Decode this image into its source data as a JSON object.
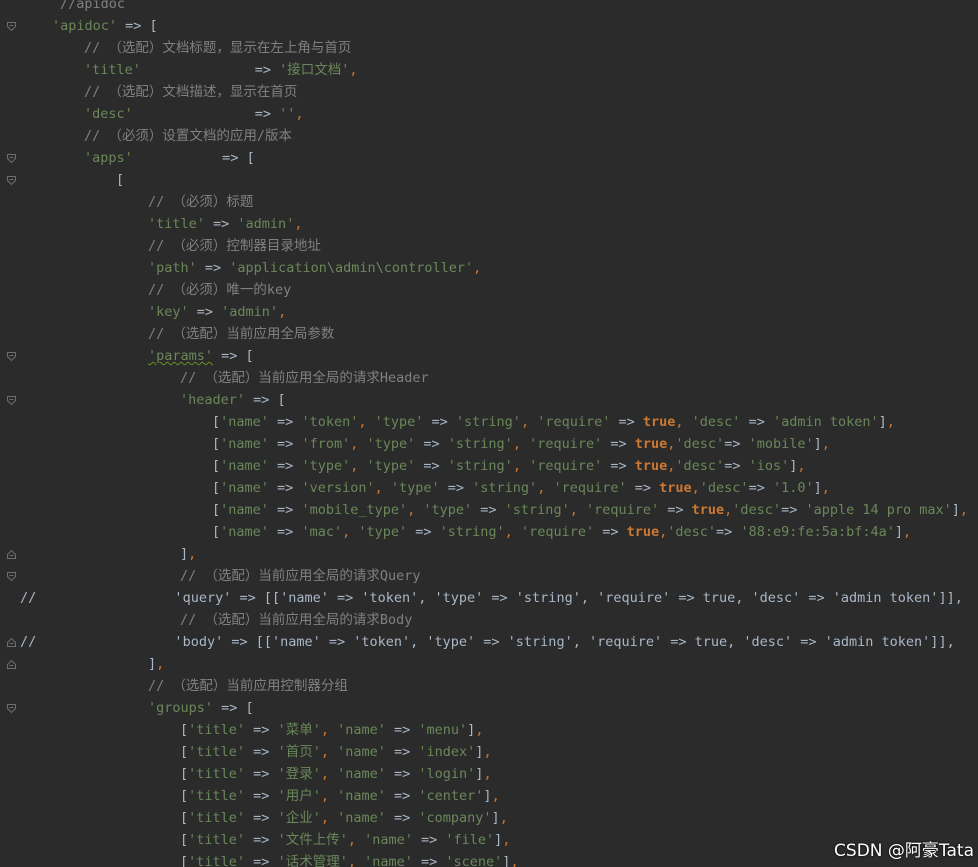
{
  "lines": [
    {
      "indent": 60,
      "tokens": [
        {
          "t": "//apidoc",
          "c": "com"
        }
      ]
    },
    {
      "indent": 52,
      "fold": "open",
      "tokens": [
        {
          "t": "'apidoc'",
          "c": "str"
        },
        {
          "t": " => [",
          "c": "p"
        }
      ]
    },
    {
      "indent": 84,
      "tokens": [
        {
          "t": "// （选配）文档标题，显示在左上角与首页",
          "c": "com"
        }
      ]
    },
    {
      "indent": 84,
      "tokens": [
        {
          "t": "'title'",
          "c": "str"
        },
        {
          "t": "              => ",
          "c": "p"
        },
        {
          "t": "'接口文档'",
          "c": "str"
        },
        {
          "t": ",",
          "c": "pc"
        }
      ]
    },
    {
      "indent": 84,
      "tokens": [
        {
          "t": "// （选配）文档描述，显示在首页",
          "c": "com"
        }
      ]
    },
    {
      "indent": 84,
      "tokens": [
        {
          "t": "'desc'",
          "c": "str"
        },
        {
          "t": "               => ",
          "c": "p"
        },
        {
          "t": "''",
          "c": "str"
        },
        {
          "t": ",",
          "c": "pc"
        }
      ]
    },
    {
      "indent": 84,
      "tokens": [
        {
          "t": "// （必须）设置文档的应用/版本",
          "c": "com"
        }
      ]
    },
    {
      "indent": 84,
      "fold": "open",
      "tokens": [
        {
          "t": "'apps'",
          "c": "str"
        },
        {
          "t": "           => [",
          "c": "p"
        }
      ]
    },
    {
      "indent": 116,
      "fold": "open",
      "tokens": [
        {
          "t": "[",
          "c": "p"
        }
      ]
    },
    {
      "indent": 148,
      "tokens": [
        {
          "t": "// （必须）标题",
          "c": "com"
        }
      ]
    },
    {
      "indent": 148,
      "tokens": [
        {
          "t": "'title'",
          "c": "str"
        },
        {
          "t": " => ",
          "c": "p"
        },
        {
          "t": "'admin'",
          "c": "str"
        },
        {
          "t": ",",
          "c": "pc"
        }
      ]
    },
    {
      "indent": 148,
      "tokens": [
        {
          "t": "// （必须）控制器目录地址",
          "c": "com"
        }
      ]
    },
    {
      "indent": 148,
      "tokens": [
        {
          "t": "'path'",
          "c": "str"
        },
        {
          "t": " => ",
          "c": "p"
        },
        {
          "t": "'application\\admin\\controller'",
          "c": "str"
        },
        {
          "t": ",",
          "c": "pc"
        }
      ]
    },
    {
      "indent": 148,
      "tokens": [
        {
          "t": "// （必须）唯一的key",
          "c": "com"
        }
      ]
    },
    {
      "indent": 148,
      "tokens": [
        {
          "t": "'key'",
          "c": "str"
        },
        {
          "t": " => ",
          "c": "p"
        },
        {
          "t": "'admin'",
          "c": "str"
        },
        {
          "t": ",",
          "c": "pc"
        }
      ]
    },
    {
      "indent": 148,
      "tokens": [
        {
          "t": "// （选配）当前应用全局参数",
          "c": "com"
        }
      ]
    },
    {
      "indent": 148,
      "fold": "open",
      "tokens": [
        {
          "t": "'params'",
          "c": "str",
          "sq": true
        },
        {
          "t": " => [",
          "c": "p"
        }
      ]
    },
    {
      "indent": 180,
      "tokens": [
        {
          "t": "// （选配）当前应用全局的请求Header",
          "c": "com"
        }
      ]
    },
    {
      "indent": 180,
      "fold": "open",
      "tokens": [
        {
          "t": "'header'",
          "c": "str"
        },
        {
          "t": " => [",
          "c": "p"
        }
      ]
    },
    {
      "indent": 212,
      "tokens": [
        {
          "t": "[",
          "c": "p"
        },
        {
          "t": "'name'",
          "c": "str"
        },
        {
          "t": " => ",
          "c": "p"
        },
        {
          "t": "'token'",
          "c": "str"
        },
        {
          "t": ", ",
          "c": "pc"
        },
        {
          "t": "'type'",
          "c": "str"
        },
        {
          "t": " => ",
          "c": "p"
        },
        {
          "t": "'string'",
          "c": "str"
        },
        {
          "t": ", ",
          "c": "pc"
        },
        {
          "t": "'require'",
          "c": "str"
        },
        {
          "t": " => ",
          "c": "p"
        },
        {
          "t": "true",
          "c": "kw"
        },
        {
          "t": ", ",
          "c": "pc"
        },
        {
          "t": "'desc'",
          "c": "str"
        },
        {
          "t": " => ",
          "c": "p"
        },
        {
          "t": "'admin token'",
          "c": "str"
        },
        {
          "t": "]",
          "c": "p"
        },
        {
          "t": ",",
          "c": "pc"
        }
      ]
    },
    {
      "indent": 212,
      "tokens": [
        {
          "t": "[",
          "c": "p"
        },
        {
          "t": "'name'",
          "c": "str"
        },
        {
          "t": " => ",
          "c": "p"
        },
        {
          "t": "'from'",
          "c": "str"
        },
        {
          "t": ", ",
          "c": "pc"
        },
        {
          "t": "'type'",
          "c": "str"
        },
        {
          "t": " => ",
          "c": "p"
        },
        {
          "t": "'string'",
          "c": "str"
        },
        {
          "t": ", ",
          "c": "pc"
        },
        {
          "t": "'require'",
          "c": "str"
        },
        {
          "t": " => ",
          "c": "p"
        },
        {
          "t": "true",
          "c": "kw"
        },
        {
          "t": ",",
          "c": "pc"
        },
        {
          "t": "'desc'",
          "c": "str"
        },
        {
          "t": "=> ",
          "c": "p"
        },
        {
          "t": "'mobile'",
          "c": "str"
        },
        {
          "t": "]",
          "c": "p"
        },
        {
          "t": ",",
          "c": "pc"
        }
      ]
    },
    {
      "indent": 212,
      "tokens": [
        {
          "t": "[",
          "c": "p"
        },
        {
          "t": "'name'",
          "c": "str"
        },
        {
          "t": " => ",
          "c": "p"
        },
        {
          "t": "'type'",
          "c": "str"
        },
        {
          "t": ", ",
          "c": "pc"
        },
        {
          "t": "'type'",
          "c": "str"
        },
        {
          "t": " => ",
          "c": "p"
        },
        {
          "t": "'string'",
          "c": "str"
        },
        {
          "t": ", ",
          "c": "pc"
        },
        {
          "t": "'require'",
          "c": "str"
        },
        {
          "t": " => ",
          "c": "p"
        },
        {
          "t": "true",
          "c": "kw"
        },
        {
          "t": ",",
          "c": "pc"
        },
        {
          "t": "'desc'",
          "c": "str"
        },
        {
          "t": "=> ",
          "c": "p"
        },
        {
          "t": "'ios'",
          "c": "str"
        },
        {
          "t": "]",
          "c": "p"
        },
        {
          "t": ",",
          "c": "pc"
        }
      ]
    },
    {
      "indent": 212,
      "tokens": [
        {
          "t": "[",
          "c": "p"
        },
        {
          "t": "'name'",
          "c": "str"
        },
        {
          "t": " => ",
          "c": "p"
        },
        {
          "t": "'version'",
          "c": "str"
        },
        {
          "t": ", ",
          "c": "pc"
        },
        {
          "t": "'type'",
          "c": "str"
        },
        {
          "t": " => ",
          "c": "p"
        },
        {
          "t": "'string'",
          "c": "str"
        },
        {
          "t": ", ",
          "c": "pc"
        },
        {
          "t": "'require'",
          "c": "str"
        },
        {
          "t": " => ",
          "c": "p"
        },
        {
          "t": "true",
          "c": "kw"
        },
        {
          "t": ",",
          "c": "pc"
        },
        {
          "t": "'desc'",
          "c": "str"
        },
        {
          "t": "=> ",
          "c": "p"
        },
        {
          "t": "'1.0'",
          "c": "str"
        },
        {
          "t": "]",
          "c": "p"
        },
        {
          "t": ",",
          "c": "pc"
        }
      ]
    },
    {
      "indent": 212,
      "tokens": [
        {
          "t": "[",
          "c": "p"
        },
        {
          "t": "'name'",
          "c": "str"
        },
        {
          "t": " => ",
          "c": "p"
        },
        {
          "t": "'mobile_type'",
          "c": "str"
        },
        {
          "t": ", ",
          "c": "pc"
        },
        {
          "t": "'type'",
          "c": "str"
        },
        {
          "t": " => ",
          "c": "p"
        },
        {
          "t": "'string'",
          "c": "str"
        },
        {
          "t": ", ",
          "c": "pc"
        },
        {
          "t": "'require'",
          "c": "str"
        },
        {
          "t": " => ",
          "c": "p"
        },
        {
          "t": "true",
          "c": "kw"
        },
        {
          "t": ",",
          "c": "pc"
        },
        {
          "t": "'desc'",
          "c": "str"
        },
        {
          "t": "=> ",
          "c": "p"
        },
        {
          "t": "'apple 14 pro max'",
          "c": "str"
        },
        {
          "t": "]",
          "c": "p"
        },
        {
          "t": ",",
          "c": "pc"
        }
      ]
    },
    {
      "indent": 212,
      "tokens": [
        {
          "t": "[",
          "c": "p"
        },
        {
          "t": "'name'",
          "c": "str"
        },
        {
          "t": " => ",
          "c": "p"
        },
        {
          "t": "'mac'",
          "c": "str"
        },
        {
          "t": ", ",
          "c": "pc"
        },
        {
          "t": "'type'",
          "c": "str"
        },
        {
          "t": " => ",
          "c": "p"
        },
        {
          "t": "'string'",
          "c": "str"
        },
        {
          "t": ", ",
          "c": "pc"
        },
        {
          "t": "'require'",
          "c": "str"
        },
        {
          "t": " => ",
          "c": "p"
        },
        {
          "t": "true",
          "c": "kw"
        },
        {
          "t": ",",
          "c": "pc"
        },
        {
          "t": "'desc'",
          "c": "str"
        },
        {
          "t": "=> ",
          "c": "p"
        },
        {
          "t": "'88:e9:fe:5a:bf:4a'",
          "c": "str"
        },
        {
          "t": "]",
          "c": "p"
        },
        {
          "t": ",",
          "c": "pc"
        }
      ]
    },
    {
      "indent": 180,
      "fold": "close",
      "tokens": [
        {
          "t": "]",
          "c": "p"
        },
        {
          "t": ",",
          "c": "pc"
        }
      ]
    },
    {
      "indent": 180,
      "fold": "open",
      "tokens": [
        {
          "t": "// （选配）当前应用全局的请求Query",
          "c": "com"
        }
      ]
    },
    {
      "indent": 20,
      "tokens": [
        {
          "t": "//",
          "c": "p"
        },
        {
          "t": "                 'query' => [['name' => 'token', 'type' => 'string', 'require' => true, 'desc' => 'admin token']],",
          "c": "p"
        }
      ]
    },
    {
      "indent": 180,
      "tokens": [
        {
          "t": "// （选配）当前应用全局的请求Body",
          "c": "com"
        }
      ]
    },
    {
      "indent": 20,
      "fold": "close",
      "tokens": [
        {
          "t": "//",
          "c": "p"
        },
        {
          "t": "                 'body' => [['name' => 'token', 'type' => 'string', 'require' => true, 'desc' => 'admin token']],",
          "c": "p"
        }
      ]
    },
    {
      "indent": 148,
      "fold": "close",
      "tokens": [
        {
          "t": "]",
          "c": "p"
        },
        {
          "t": ",",
          "c": "pc"
        }
      ]
    },
    {
      "indent": 148,
      "tokens": [
        {
          "t": "// （选配）当前应用控制器分组",
          "c": "com"
        }
      ]
    },
    {
      "indent": 148,
      "fold": "open",
      "tokens": [
        {
          "t": "'groups'",
          "c": "str"
        },
        {
          "t": " => [",
          "c": "p"
        }
      ]
    },
    {
      "indent": 180,
      "tokens": [
        {
          "t": "[",
          "c": "p"
        },
        {
          "t": "'title'",
          "c": "str"
        },
        {
          "t": " => ",
          "c": "p"
        },
        {
          "t": "'菜单'",
          "c": "str"
        },
        {
          "t": ", ",
          "c": "pc"
        },
        {
          "t": "'name'",
          "c": "str"
        },
        {
          "t": " => ",
          "c": "p"
        },
        {
          "t": "'menu'",
          "c": "str"
        },
        {
          "t": "]",
          "c": "p"
        },
        {
          "t": ",",
          "c": "pc"
        }
      ]
    },
    {
      "indent": 180,
      "tokens": [
        {
          "t": "[",
          "c": "p"
        },
        {
          "t": "'title'",
          "c": "str"
        },
        {
          "t": " => ",
          "c": "p"
        },
        {
          "t": "'首页'",
          "c": "str"
        },
        {
          "t": ", ",
          "c": "pc"
        },
        {
          "t": "'name'",
          "c": "str"
        },
        {
          "t": " => ",
          "c": "p"
        },
        {
          "t": "'index'",
          "c": "str"
        },
        {
          "t": "]",
          "c": "p"
        },
        {
          "t": ",",
          "c": "pc"
        }
      ]
    },
    {
      "indent": 180,
      "tokens": [
        {
          "t": "[",
          "c": "p"
        },
        {
          "t": "'title'",
          "c": "str"
        },
        {
          "t": " => ",
          "c": "p"
        },
        {
          "t": "'登录'",
          "c": "str"
        },
        {
          "t": ", ",
          "c": "pc"
        },
        {
          "t": "'name'",
          "c": "str"
        },
        {
          "t": " => ",
          "c": "p"
        },
        {
          "t": "'login'",
          "c": "str"
        },
        {
          "t": "]",
          "c": "p"
        },
        {
          "t": ",",
          "c": "pc"
        }
      ]
    },
    {
      "indent": 180,
      "tokens": [
        {
          "t": "[",
          "c": "p"
        },
        {
          "t": "'title'",
          "c": "str"
        },
        {
          "t": " => ",
          "c": "p"
        },
        {
          "t": "'用户'",
          "c": "str"
        },
        {
          "t": ", ",
          "c": "pc"
        },
        {
          "t": "'name'",
          "c": "str"
        },
        {
          "t": " => ",
          "c": "p"
        },
        {
          "t": "'center'",
          "c": "str"
        },
        {
          "t": "]",
          "c": "p"
        },
        {
          "t": ",",
          "c": "pc"
        }
      ]
    },
    {
      "indent": 180,
      "tokens": [
        {
          "t": "[",
          "c": "p"
        },
        {
          "t": "'title'",
          "c": "str"
        },
        {
          "t": " => ",
          "c": "p"
        },
        {
          "t": "'企业'",
          "c": "str"
        },
        {
          "t": ", ",
          "c": "pc"
        },
        {
          "t": "'name'",
          "c": "str"
        },
        {
          "t": " => ",
          "c": "p"
        },
        {
          "t": "'company'",
          "c": "str"
        },
        {
          "t": "]",
          "c": "p"
        },
        {
          "t": ",",
          "c": "pc"
        }
      ]
    },
    {
      "indent": 180,
      "tokens": [
        {
          "t": "[",
          "c": "p"
        },
        {
          "t": "'title'",
          "c": "str"
        },
        {
          "t": " => ",
          "c": "p"
        },
        {
          "t": "'文件上传'",
          "c": "str"
        },
        {
          "t": ", ",
          "c": "pc"
        },
        {
          "t": "'name'",
          "c": "str"
        },
        {
          "t": " => ",
          "c": "p"
        },
        {
          "t": "'file'",
          "c": "str"
        },
        {
          "t": "]",
          "c": "p"
        },
        {
          "t": ",",
          "c": "pc"
        }
      ]
    },
    {
      "indent": 180,
      "tokens": [
        {
          "t": "[",
          "c": "p"
        },
        {
          "t": "'title'",
          "c": "str"
        },
        {
          "t": " => ",
          "c": "p"
        },
        {
          "t": "'话术管理'",
          "c": "str"
        },
        {
          "t": ", ",
          "c": "pc"
        },
        {
          "t": "'name'",
          "c": "str"
        },
        {
          "t": " => ",
          "c": "p"
        },
        {
          "t": "'scene'",
          "c": "str"
        },
        {
          "t": "]",
          "c": "p"
        },
        {
          "t": ",",
          "c": "pc"
        }
      ]
    }
  ],
  "watermark": "CSDN @阿豪Tata"
}
